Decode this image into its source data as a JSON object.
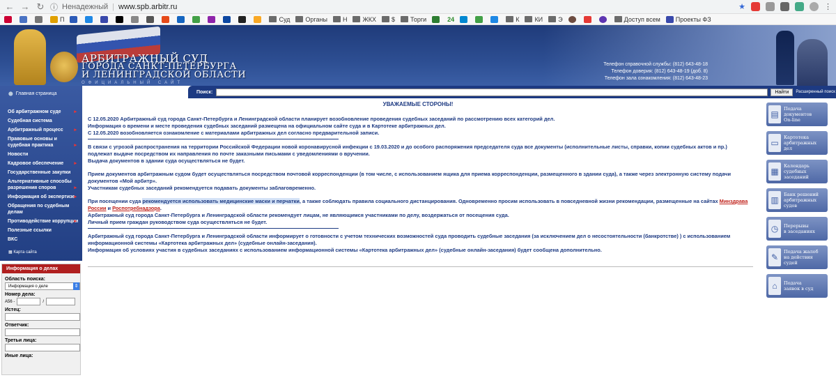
{
  "browser": {
    "not_secure": "Ненадежный",
    "url": "www.spb.arbitr.ru",
    "bookmarks": [
      "П",
      "Суд",
      "Органы",
      "Н",
      "ЖКХ",
      "$",
      "Торги",
      "24",
      "К",
      "КИ",
      "Э",
      "Доступ всем",
      "Проекты ФЗ"
    ]
  },
  "header": {
    "title_line1": "АРБИТРАЖНЫЙ СУД",
    "title_line2": "ГОРОДА САНКТ-ПЕТЕРБУРГА",
    "title_line3": "И ЛЕНИНГРАДСКОЙ ОБЛАСТИ",
    "subtitle": "ОФИЦИАЛЬНЫЙ САЙТ",
    "phone1": "Телефон справочной службы: (812) 643-48-18",
    "phone2": "Телефон доверия: (812) 643-48-19 (доб. 8)",
    "phone3": "Телефон зала ознакомления: (812) 643-48-23"
  },
  "sidebar": {
    "home": "Главная страница",
    "items": [
      {
        "label": "Об арбитражном суде"
      },
      {
        "label": "Судебная система"
      },
      {
        "label": "Арбитражный процесс"
      },
      {
        "label": "Правовые основы и судебная практика"
      },
      {
        "label": "Новости"
      },
      {
        "label": "Кадровое обеспечение"
      },
      {
        "label": "Государственные закупки"
      },
      {
        "label": "Альтернативные способы разрешения споров"
      },
      {
        "label": "Информация об экспертизе"
      },
      {
        "label": "Обращения по судебным делам"
      },
      {
        "label": "Противодействие коррупции"
      },
      {
        "label": "Полезные ссылки"
      },
      {
        "label": "ВКС"
      }
    ],
    "sitemap": "Карта сайта"
  },
  "cases": {
    "title": "Информация о делах",
    "area_label": "Область поиска:",
    "area_value": "Информация о деле",
    "number_label": "Номер дела:",
    "number_prefix": "А56 -",
    "number_sep": "/",
    "plaintiff_label": "Истец:",
    "defendant_label": "Ответчик:",
    "third_label": "Третьи лица:",
    "others_label": "Иные лица:"
  },
  "search": {
    "label": "Поиск:",
    "button": "Найти",
    "advanced": "Расширенный поиск"
  },
  "content": {
    "heading": "УВАЖАЕМЫЕ СТОРОНЫ!",
    "p1": "С 12.05.2020 Арбитражный суд города Санкт-Петербурга и Ленинградской области планирует возобновление проведения судебных заседаний по рассмотрению всех категорий дел.",
    "p2": "Информация о времени и месте проведения судебных заседаний размещена  на официальном сайте суда и в Картотеке арбитражных дел.",
    "p3": "С 12.05.2020 возобновляется ознакомление с материалами арбитражных дел согласно предварительной записи.",
    "p4": "В связи с угрозой распространения на территории Российской Федерации новой коронавирусной инфекции с 19.03.2020 и до особого распоряжения председателя суда все документы (исполнительные листы, справки, копии судебных актов и пр.) подлежат выдаче посредством их направления по почте заказными письмами с уведомлениями о вручении.",
    "p5": "Выдача  документов в здании суда осуществляться не будет.",
    "p6": "Прием документов арбитражным судом будет осуществляться посредством почтовой корреспонденции (в том числе, с использованием ящика для приема корреспонденции, размещенного в здании суда), а также через электронную систему подачи документов «Мой арбитр».",
    "p7": "Участникам судебных заседаний рекомендуется подавать документы заблаговременно.",
    "p8_a": "При посещении суда ",
    "p8_hl": "рекомендуется использовать медицинские маски и перчатки",
    "p8_b": ", а также соблюдать правила социального дистанцирования. Одновременно просим использовать в повседневной жизни рекомендации, размещенные на сайтах ",
    "link1": "Минздрава России",
    "p8_and": " и ",
    "link2": "Роспотребнадзора",
    "p8_end": ".",
    "p9": "Арбитражный суд города Санкт-Петербурга и Ленинградской области рекомендует лицам, не являющимся участниками по делу, воздержаться от посещения суда.",
    "p10": "Личный прием граждан руководством суда осуществляться не будет.",
    "p11": "Арбитражный суд города Санкт-Петербурга и Ленинградской области информирует о готовности с учетом технических возможностей суда проводить судебные заседания (за исключением дел о несостоятельности (банкротстве) ) с использованием информационной системы «Картотека арбитражных дел» (судебные онлайн-заседания).",
    "p12": "Информация об условиях участия в судебных заседаниях с использованием информационной системы «Картотека арбитражных дел» (судебные онлайн-заседания) будет сообщена дополнительно."
  },
  "right_buttons": [
    {
      "l1": "Подача",
      "l2": "документов",
      "l3": "On-line",
      "icon": "document-icon"
    },
    {
      "l1": "Картотека",
      "l2": "арбитражных",
      "l3": "дел",
      "icon": "folder-icon"
    },
    {
      "l1": "Календарь",
      "l2": "судебных",
      "l3": "заседаний",
      "icon": "calendar-icon"
    },
    {
      "l1": "Банк решений",
      "l2": "арбитражных",
      "l3": "судов",
      "icon": "bank-icon"
    },
    {
      "l1": "Перерывы",
      "l2": "в заседаниях",
      "l3": "",
      "icon": "clock-icon"
    },
    {
      "l1": "Подача жалоб",
      "l2": "на действия",
      "l3": "судей",
      "icon": "complaint-icon"
    },
    {
      "l1": "Подача",
      "l2": "заявок в суд",
      "l3": "",
      "icon": "application-icon"
    }
  ]
}
